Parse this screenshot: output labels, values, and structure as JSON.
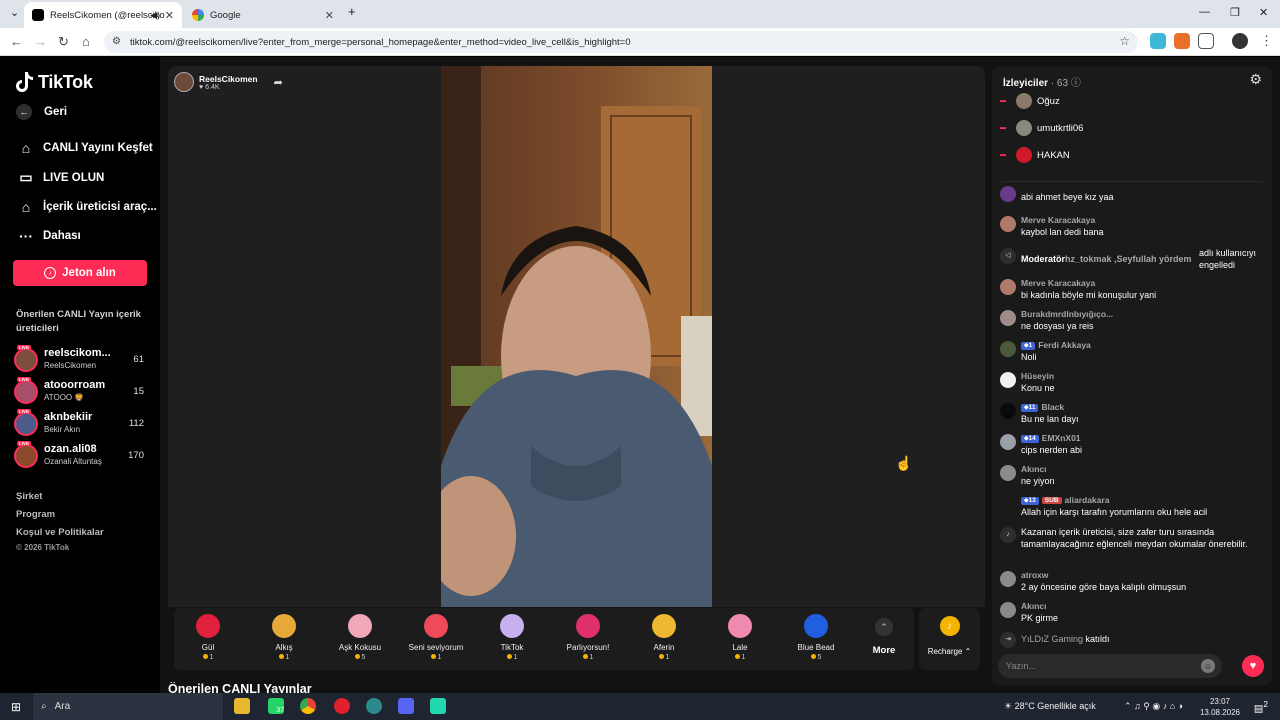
{
  "browser": {
    "tabs": [
      {
        "title": "ReelsCikomen (@reelsciko",
        "active": true
      },
      {
        "title": "Google",
        "active": false
      }
    ],
    "url": "tiktok.com/@reelscikomen/live?enter_from_merge=personal_homepage&enter_method=video_live_cell&is_highlight=0"
  },
  "sidebar": {
    "logo": "TikTok",
    "back": "Geri",
    "nav": [
      {
        "label": "CANLI Yayını Keşfet",
        "icon": "live-explore-icon"
      },
      {
        "label": "LIVE OLUN",
        "icon": "video-camera-icon"
      },
      {
        "label": "İçerik üreticisi araç...",
        "icon": "creator-tools-icon"
      },
      {
        "label": "Dahası",
        "icon": "more-dots-icon"
      }
    ],
    "coin_button": "Jeton alın",
    "section_title": "Önerilen CANLI Yayın içerik üreticileri",
    "creators": [
      {
        "handle": "reelscikom...",
        "name": "ReelsCikomen",
        "count": "61",
        "color": "#7a4e3a"
      },
      {
        "handle": "atooorroam",
        "name": "ATOOO 🦁",
        "count": "15",
        "color": "#a84d6a"
      },
      {
        "handle": "aknbekiir",
        "name": "Bekir Akın",
        "count": "112",
        "color": "#4d5a8a"
      },
      {
        "handle": "ozan.ali08",
        "name": "Ozanali Altuntaş",
        "count": "170",
        "color": "#8a4a2a"
      }
    ],
    "live_tag": "LIVE",
    "footer": [
      "Şirket",
      "Program",
      "Koşul ve Politikalar"
    ],
    "copyright": "© 2026 TikTok"
  },
  "stream": {
    "host_name": "ReelsCikomen",
    "host_likes": "6.4K",
    "suggested_heading": "Önerilen CANLI Yayınlar"
  },
  "gifts": {
    "items": [
      {
        "name": "Gül",
        "price": "1",
        "color": "#e0203c"
      },
      {
        "name": "Alkış",
        "price": "1",
        "color": "#e8a83a"
      },
      {
        "name": "Aşk Kokusu",
        "price": "5",
        "color": "#f0a8b8"
      },
      {
        "name": "Seni seviyorum",
        "price": "1",
        "color": "#f04a5a"
      },
      {
        "name": "TikTok",
        "price": "1",
        "color": "#c8b0f0"
      },
      {
        "name": "Parlıyorsun!",
        "price": "1",
        "color": "#e0306a"
      },
      {
        "name": "Aferin",
        "price": "1",
        "color": "#f0b830"
      },
      {
        "name": "Lale",
        "price": "1",
        "color": "#f08ab0"
      },
      {
        "name": "Blue Bead",
        "price": "5",
        "color": "#2060e0"
      }
    ],
    "more_label": "More",
    "recharge_label": "Recharge"
  },
  "chat": {
    "viewers_label": "İzleyiciler",
    "viewer_count": "63",
    "top_viewers": [
      {
        "name": "Oğuz",
        "color": "#8a7a6a"
      },
      {
        "name": "umutkrtli06",
        "color": "#8a8a7a"
      },
      {
        "name": "HAKAN",
        "color": "#d01a2a"
      }
    ],
    "messages": [
      {
        "kind": "msg",
        "user": "",
        "text": "abi ahmet beye kız yaa",
        "color": "#6a3a8a"
      },
      {
        "kind": "msg",
        "user": "Merve Karacakaya",
        "text": "kaybol lan dedi bana",
        "color": "#b07a6a"
      },
      {
        "kind": "mod",
        "prefix": "Moderatör",
        "users": "hz_tokmak ,Seyfullah yördem",
        "text": "adlı kullanıcıyı engelledi"
      },
      {
        "kind": "msg",
        "user": "Merve Karacakaya",
        "text": "bi kadınla böyle mi konuşulur yani",
        "color": "#b07a6a"
      },
      {
        "kind": "msg",
        "user": "Burakdmrdlnbıyığıço...",
        "text": "ne dosyası ya reis",
        "color": "#a08a8a"
      },
      {
        "kind": "msg",
        "level": "1",
        "user": "Ferdi Akkaya",
        "text": "Noli",
        "color": "#4a5a3a"
      },
      {
        "kind": "msg",
        "user": "Hüseyin",
        "text": "Konu ne",
        "color": "#f0f0f0"
      },
      {
        "kind": "msg",
        "level": "11",
        "user": "Black",
        "text": "Bu ne lan dayı",
        "color": "#0a0a0a"
      },
      {
        "kind": "msg",
        "level": "14",
        "user": "EMXnX01",
        "text": "cips nerden abi",
        "color": "#9aa0a8"
      },
      {
        "kind": "msg",
        "user": "Akıncı",
        "text": "ne yiyon",
        "color": "#8a8a8a"
      },
      {
        "kind": "msg",
        "level": "13",
        "sub": "SUB",
        "user": "aliardakara",
        "text": "Allah için karşı tarafın yorumlarını oku hele acil",
        "color": "#1a1a1a"
      },
      {
        "kind": "system",
        "text": "Kazanan içerik üreticisi, size zafer turu sırasında tamamlayacağınız eğlenceli meydan okumalar önerebilir."
      },
      {
        "kind": "msg",
        "user": "atroxw",
        "text": "2 ay öncesine göre baya kalıplı olmuşsun",
        "color": "#8a8a8a"
      },
      {
        "kind": "msg",
        "user": "Akıncı",
        "text": "PK girme",
        "color": "#8a8a8a"
      },
      {
        "kind": "join",
        "user": "YıLDıZ Gaming",
        "text": "katıldı"
      }
    ],
    "input_placeholder": "Yazın..."
  },
  "taskbar": {
    "search": "Ara",
    "whatsapp_count": "37",
    "weather": "28°C  Genellikle açık",
    "time": "23:07",
    "date": "13.08.2026",
    "notifications": "2"
  }
}
